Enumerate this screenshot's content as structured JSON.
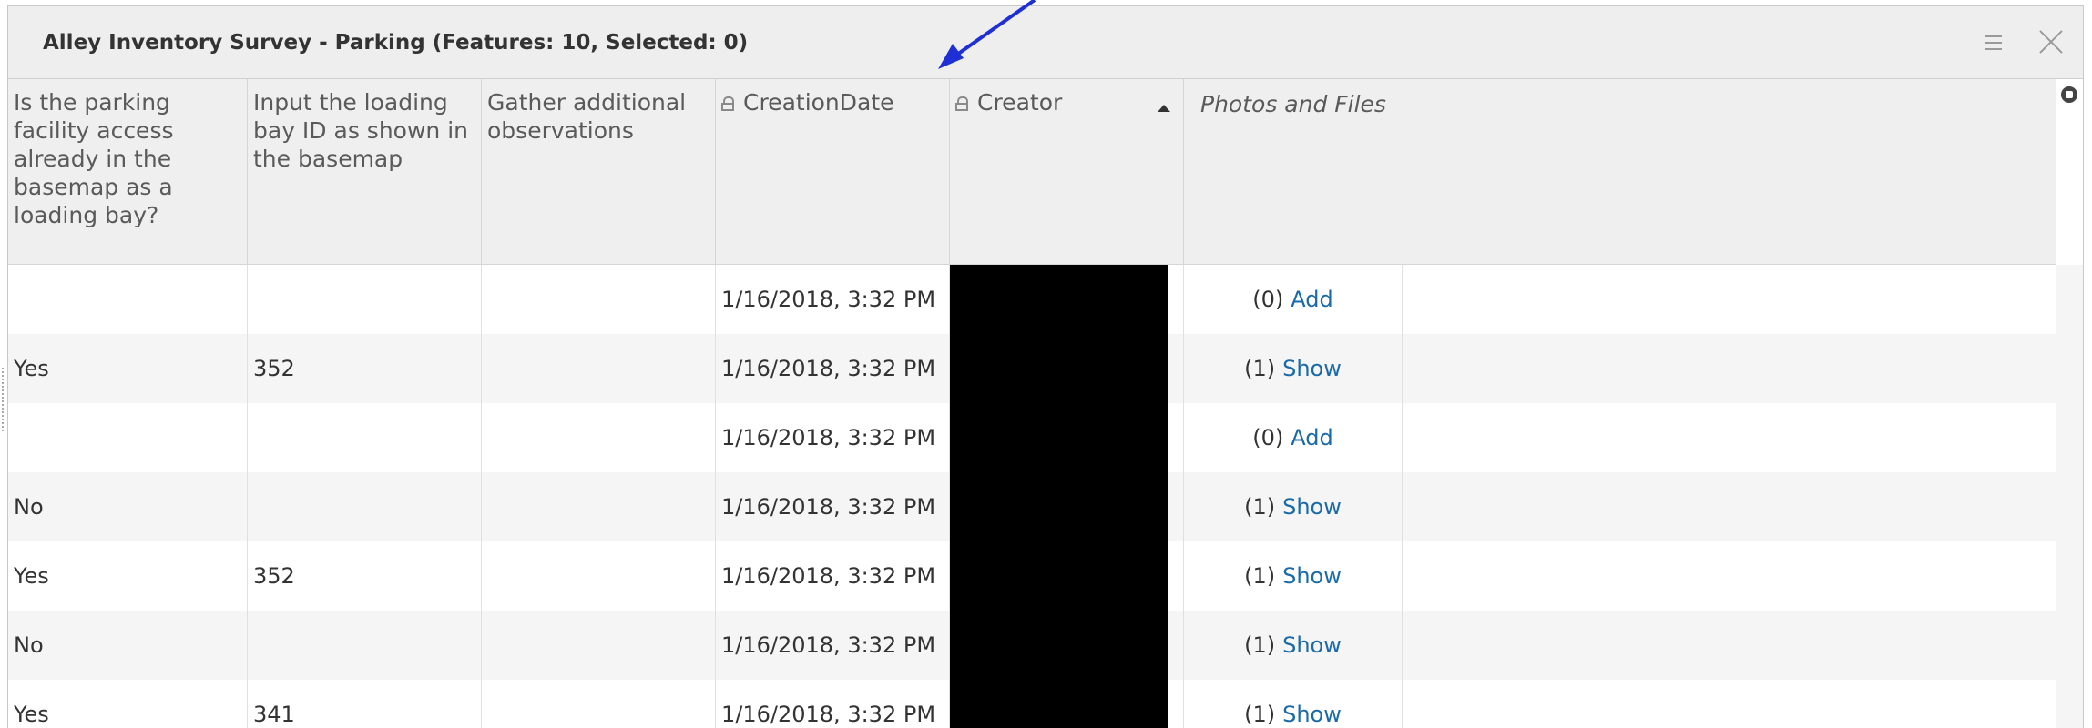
{
  "window": {
    "title": "Alley Inventory Survey - Parking (Features: 10, Selected: 0)"
  },
  "columns": [
    {
      "label": "Is the parking facility access already in the basemap as a loading bay?",
      "locked": false
    },
    {
      "label": "Input the loading bay ID as shown in the basemap",
      "locked": false
    },
    {
      "label": "Gather additional observations",
      "locked": false
    },
    {
      "label": "CreationDate",
      "locked": true
    },
    {
      "label": "Creator",
      "locked": true,
      "sorted": "ascending"
    },
    {
      "label": "Photos and Files",
      "locked": false
    }
  ],
  "rows": [
    {
      "loading_bay": "",
      "bay_id": "",
      "observations": "",
      "creation_date": "1/16/2018, 3:32 PM",
      "pf_count": "(0)",
      "pf_action": "Add"
    },
    {
      "loading_bay": "Yes",
      "bay_id": "352",
      "observations": "",
      "creation_date": "1/16/2018, 3:32 PM",
      "pf_count": "(1)",
      "pf_action": "Show"
    },
    {
      "loading_bay": "",
      "bay_id": "",
      "observations": "",
      "creation_date": "1/16/2018, 3:32 PM",
      "pf_count": "(0)",
      "pf_action": "Add"
    },
    {
      "loading_bay": "No",
      "bay_id": "",
      "observations": "",
      "creation_date": "1/16/2018, 3:32 PM",
      "pf_count": "(1)",
      "pf_action": "Show"
    },
    {
      "loading_bay": "Yes",
      "bay_id": "352",
      "observations": "",
      "creation_date": "1/16/2018, 3:32 PM",
      "pf_count": "(1)",
      "pf_action": "Show"
    },
    {
      "loading_bay": "No",
      "bay_id": "",
      "observations": "",
      "creation_date": "1/16/2018, 3:32 PM",
      "pf_count": "(1)",
      "pf_action": "Show"
    },
    {
      "loading_bay": "Yes",
      "bay_id": "341",
      "observations": "",
      "creation_date": "1/16/2018, 3:32 PM",
      "pf_count": "(1)",
      "pf_action": "Show"
    }
  ],
  "icons": {
    "menu": "menu-icon",
    "close": "close-icon",
    "lock": "lock-icon",
    "sort": "sort-ascending-icon",
    "column_options": "column-options-icon"
  },
  "colors": {
    "link": "#1a6aa8",
    "annotation_arrow": "#1f2fd6",
    "header_bg": "#efefef",
    "titlebar_bg": "#eeeeee"
  }
}
